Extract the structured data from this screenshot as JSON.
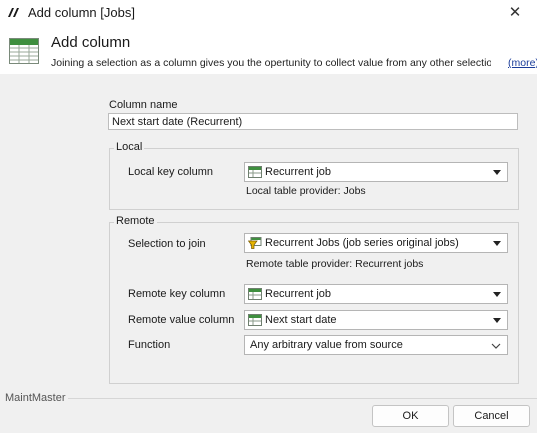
{
  "window": {
    "title": "Add column [Jobs]",
    "close_glyph": "✕"
  },
  "header": {
    "title": "Add column",
    "description": "Joining a selection as a column gives you the opertunity to collect value from any other selectio...",
    "more_link": "(more)"
  },
  "column_name": {
    "label": "Column name",
    "value": "Next start date (Recurrent)"
  },
  "local": {
    "group_title": "Local",
    "key_column_label": "Local key column",
    "key_column_value": "Recurrent job",
    "provider_text": "Local table provider: Jobs"
  },
  "remote": {
    "group_title": "Remote",
    "selection_label": "Selection to join",
    "selection_value": "Recurrent Jobs (job series original jobs)",
    "provider_text": "Remote table provider: Recurrent jobs",
    "key_column_label": "Remote key column",
    "key_column_value": "Recurrent job",
    "value_column_label": "Remote value column",
    "value_column_value": "Next start date",
    "function_label": "Function",
    "function_value": "Any arbitrary value from source"
  },
  "footer": {
    "brand": "MaintMaster",
    "ok_label": "OK",
    "cancel_label": "Cancel"
  },
  "icons": {
    "app": "maintmaster-logo-icon",
    "header": "table-add-column-icon",
    "table_column": "table-icon",
    "selection": "selection-funnel-icon"
  }
}
